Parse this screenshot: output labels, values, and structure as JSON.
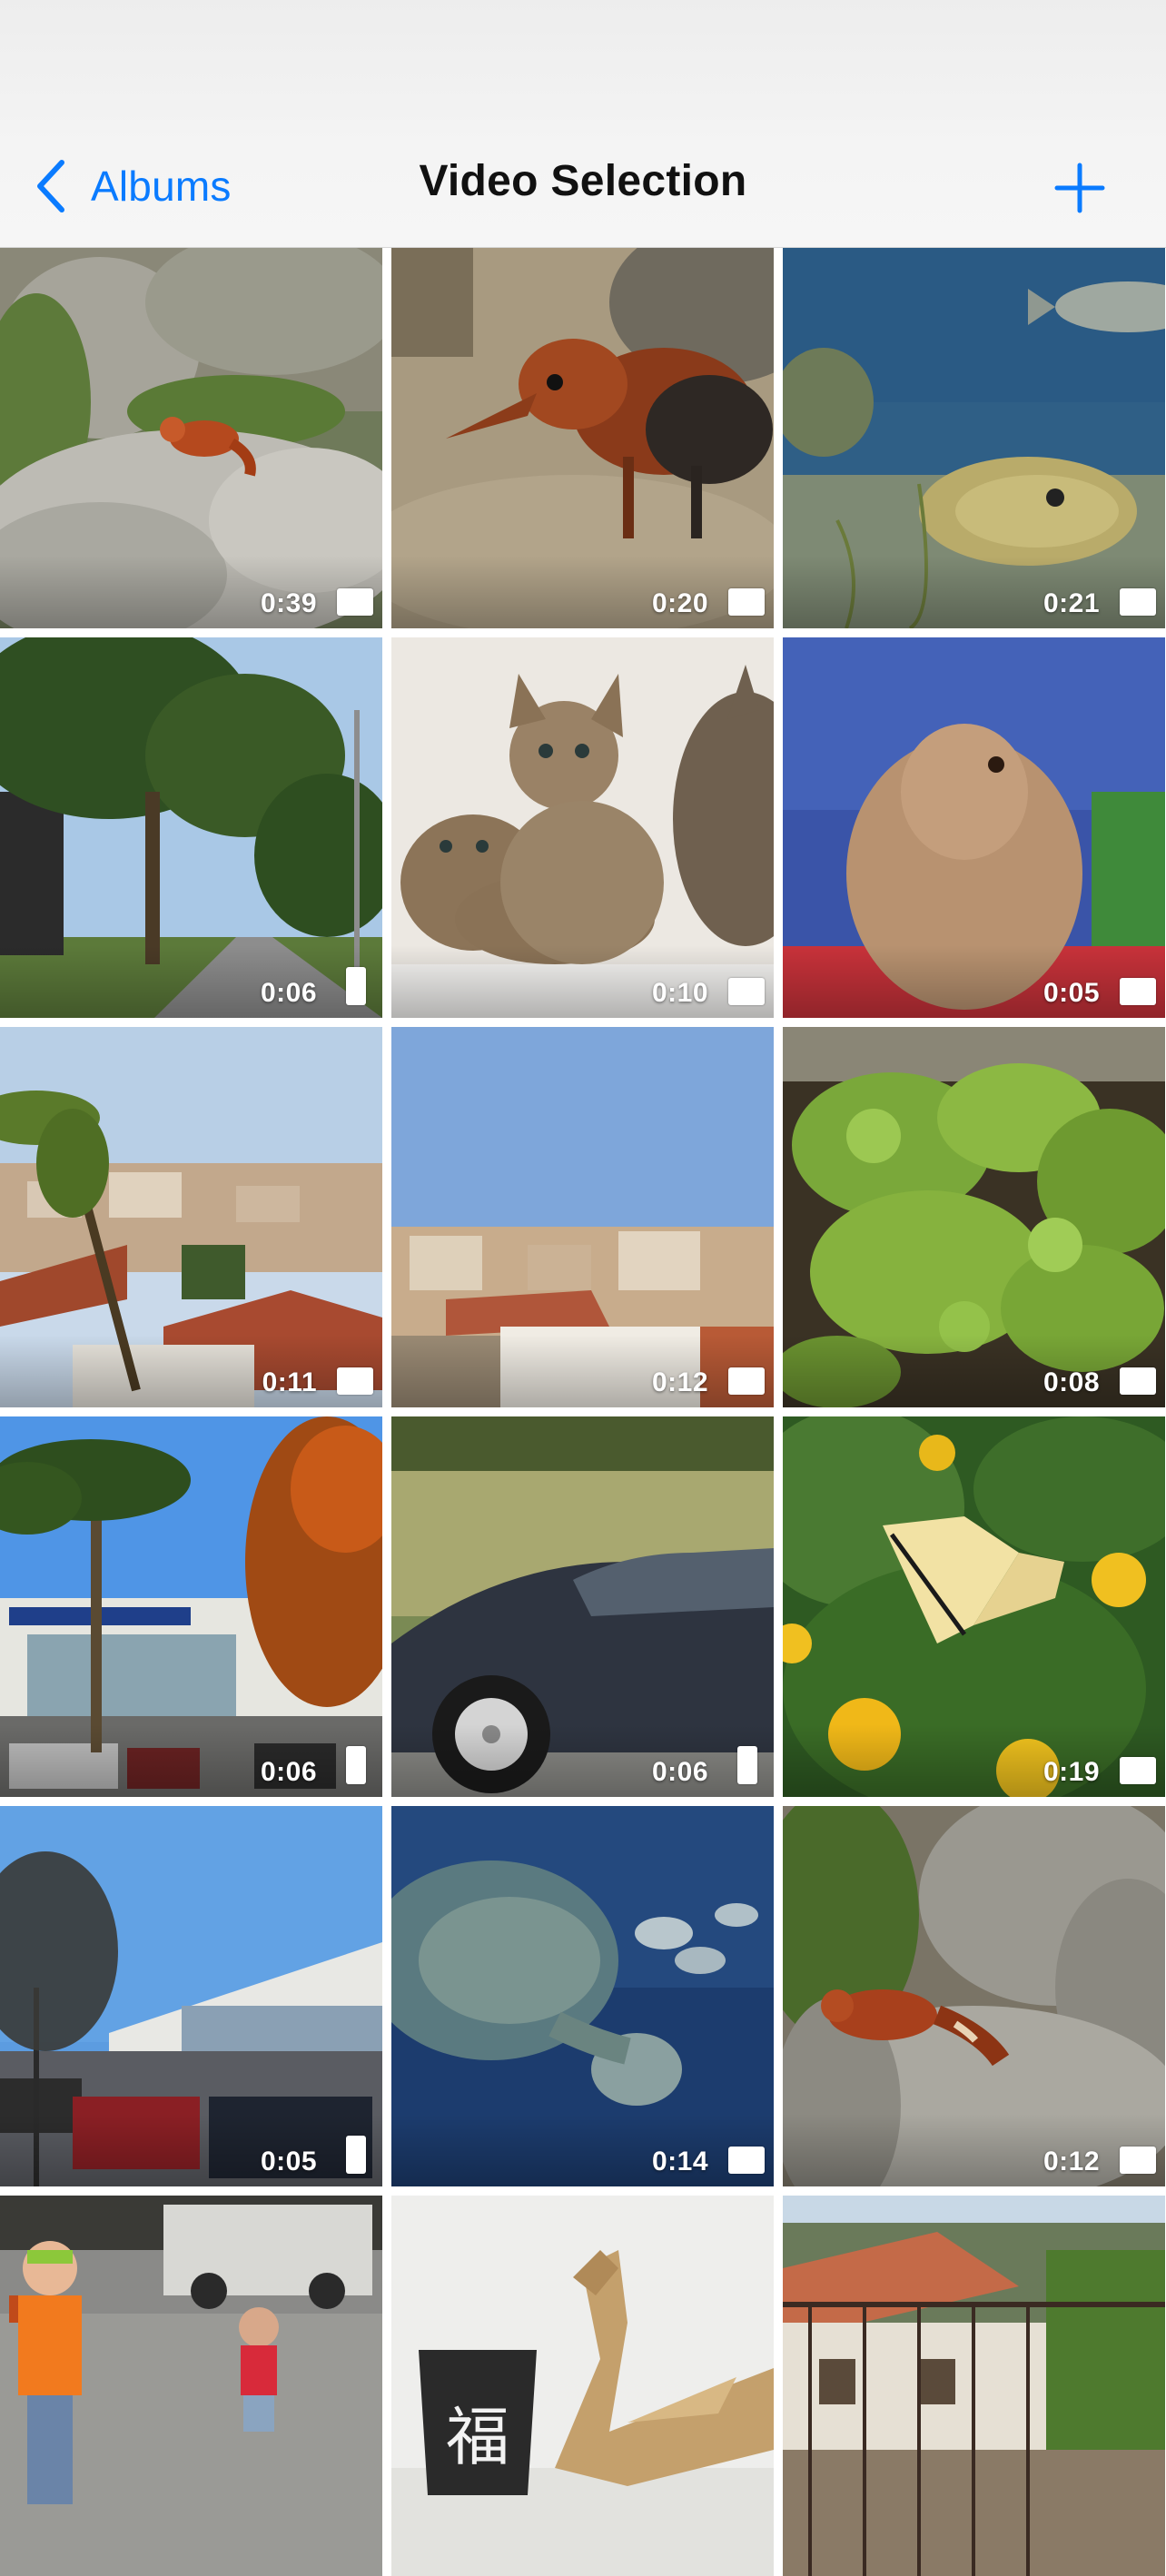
{
  "navbar": {
    "back_label": "Albums",
    "title": "Video Selection",
    "accent_color": "#0a7bff",
    "add_icon": "plus-icon",
    "back_icon": "chevron-left-icon"
  },
  "videos": [
    {
      "duration": "0:39",
      "subject": "red-panda-rocks"
    },
    {
      "duration": "0:20",
      "subject": "elephant-shrew"
    },
    {
      "duration": "0:21",
      "subject": "aquarium-fish"
    },
    {
      "duration": "0:06",
      "subject": "pine-tree-street"
    },
    {
      "duration": "0:10",
      "subject": "kittens"
    },
    {
      "duration": "0:05",
      "subject": "hamster"
    },
    {
      "duration": "0:11",
      "subject": "town-view-palm"
    },
    {
      "duration": "0:12",
      "subject": "town-rooftops"
    },
    {
      "duration": "0:08",
      "subject": "succulent-plants"
    },
    {
      "duration": "0:06",
      "subject": "palm-car-dealer"
    },
    {
      "duration": "0:06",
      "subject": "dark-car"
    },
    {
      "duration": "0:19",
      "subject": "butterfly-flowers"
    },
    {
      "duration": "0:05",
      "subject": "parking-lot-buildings"
    },
    {
      "duration": "0:14",
      "subject": "sea-turtle"
    },
    {
      "duration": "0:12",
      "subject": "red-panda-walking"
    },
    {
      "duration": "",
      "subject": "children-parking"
    },
    {
      "duration": "",
      "subject": "origami-dragon"
    },
    {
      "duration": "",
      "subject": "balcony-view"
    }
  ]
}
